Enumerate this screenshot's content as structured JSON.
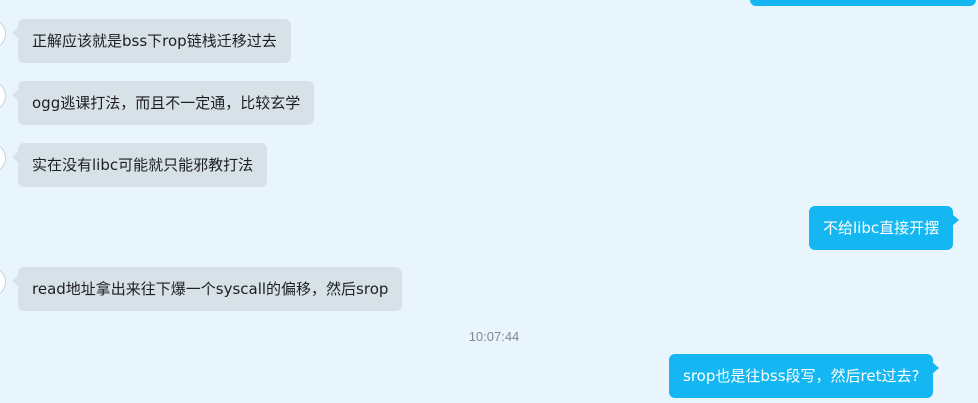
{
  "colors": {
    "background": "#e9f5fd",
    "incoming_bubble": "#d6e1e8",
    "outgoing_bubble": "#14b7f1",
    "timestamp": "#7e8a93"
  },
  "messages": [
    {
      "direction": "outgoing",
      "text": ""
    },
    {
      "direction": "incoming",
      "text": "正解应该就是bss下rop链栈迁移过去"
    },
    {
      "direction": "incoming",
      "text": "ogg逃课打法，而且不一定通，比较玄学"
    },
    {
      "direction": "incoming",
      "text": "实在没有libc可能就只能邪教打法"
    },
    {
      "direction": "outgoing",
      "text": "不给libc直接开摆"
    },
    {
      "direction": "incoming",
      "text": "read地址拿出来往下爆一个syscall的偏移，然后srop"
    },
    {
      "direction": "outgoing",
      "text": "srop也是往bss段写，然后ret过去?"
    }
  ],
  "timestamp": "10:07:44"
}
